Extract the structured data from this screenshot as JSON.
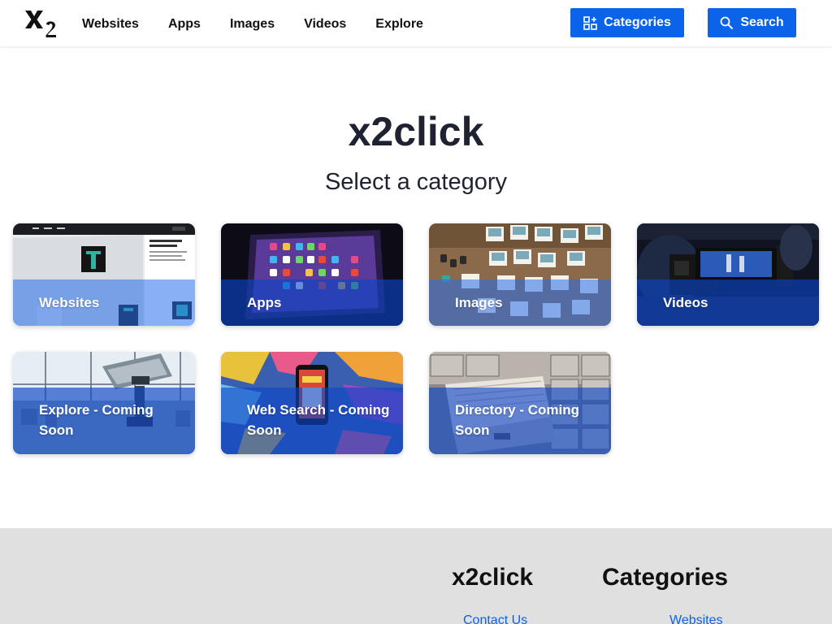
{
  "header": {
    "logo": "x2",
    "nav": [
      "Websites",
      "Apps",
      "Images",
      "Videos",
      "Explore"
    ],
    "categories_button": "Categories",
    "search_button": "Search"
  },
  "hero": {
    "title": "x2click",
    "subtitle": "Select a category"
  },
  "cards": [
    {
      "label": "Websites",
      "image": "website-screens"
    },
    {
      "label": "Apps",
      "image": "tablet-app-icons"
    },
    {
      "label": "Images",
      "image": "photo-prints-on-table"
    },
    {
      "label": "Videos",
      "image": "camera-filming-boxing"
    },
    {
      "label": "Explore - Coming Soon",
      "image": "tower-viewer-binoculars"
    },
    {
      "label": "Web Search - Coming Soon",
      "image": "phone-on-graffiti"
    },
    {
      "label": "Directory - Coming Soon",
      "image": "filing-cabinet-drawer"
    }
  ],
  "footer": {
    "col1": {
      "title": "x2click",
      "links": [
        "Contact Us"
      ]
    },
    "col2": {
      "title": "Categories",
      "links": [
        "Websites"
      ]
    }
  },
  "colors": {
    "accent": "#0b63ea",
    "card_overlay": "#0b46c8",
    "footer_bg": "#e0e0e0",
    "text": "#1f2230"
  }
}
